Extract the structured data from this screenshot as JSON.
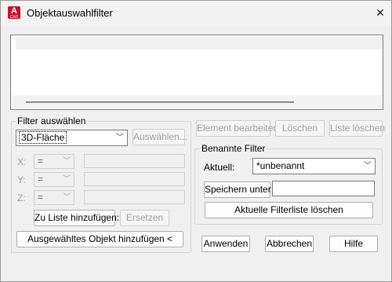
{
  "window": {
    "title": "Objektauswahlfilter",
    "icon_letter": "A",
    "icon_sub": "CAD",
    "close_glyph": "✕"
  },
  "filter_select": {
    "group_label": "Filter auswählen",
    "type_value": "3D-Fläche",
    "select_button": "Auswählen...",
    "axes": [
      {
        "label": "X:",
        "operator": "="
      },
      {
        "label": "Y:",
        "operator": "="
      },
      {
        "label": "Z:",
        "operator": "="
      }
    ],
    "add_to_list_button": "Zu Liste hinzufügen:",
    "replace_button": "Ersetzen",
    "add_selected_button": "Ausgewähltes Objekt hinzufügen <"
  },
  "list_actions": {
    "edit_button": "Element bearbeiten",
    "delete_button": "Löschen",
    "clear_list_button": "Liste löschen"
  },
  "named_filters": {
    "group_label": "Benannte Filter",
    "current_label": "Aktuell:",
    "current_value": "*unbenannt",
    "save_as_button": "Speichern unter:",
    "save_as_value": "",
    "delete_current_button": "Aktuelle Filterliste löschen"
  },
  "footer": {
    "apply_button": "Anwenden",
    "cancel_button": "Abbrechen",
    "help_button": "Hilfe"
  },
  "colors": {
    "accent_red": "#c8102e",
    "disabled_text": "#a0a0a0"
  }
}
